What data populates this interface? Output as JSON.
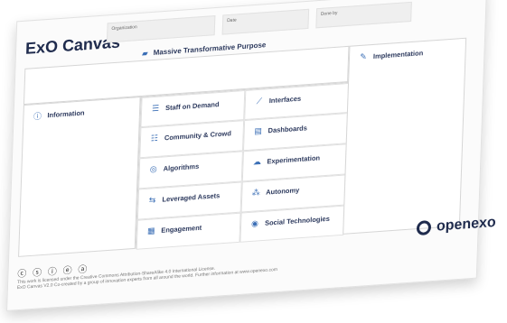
{
  "header": {
    "title": "ExO Canvas",
    "fields": [
      {
        "label": "Organization"
      },
      {
        "label": "Date"
      },
      {
        "label": "Done by"
      }
    ]
  },
  "mtp": {
    "label": "Massive Transformative Purpose"
  },
  "columns": {
    "information": "Information",
    "implementation": "Implementation"
  },
  "scale": [
    {
      "label": "Staff on Demand",
      "icon": "staff-icon"
    },
    {
      "label": "Community & Crowd",
      "icon": "community-icon"
    },
    {
      "label": "Algorithms",
      "icon": "algorithm-icon"
    },
    {
      "label": "Leveraged Assets",
      "icon": "leveraged-assets-icon"
    },
    {
      "label": "Engagement",
      "icon": "engagement-icon"
    }
  ],
  "ideas": [
    {
      "label": "Interfaces",
      "icon": "interfaces-icon"
    },
    {
      "label": "Dashboards",
      "icon": "dashboards-icon"
    },
    {
      "label": "Experimentation",
      "icon": "experimentation-icon"
    },
    {
      "label": "Autonomy",
      "icon": "autonomy-icon"
    },
    {
      "label": "Social Technologies",
      "icon": "social-technologies-icon"
    }
  ],
  "footer": {
    "license_text": "This work is licensed under the Creative Commons Attribution-ShareAlike 4.0 International License.",
    "credit": "ExO Canvas V2.0 Co-created by a group of innovation experts from all around the world. Further information at www.openexo.com"
  },
  "brand": {
    "name": "openexo"
  }
}
